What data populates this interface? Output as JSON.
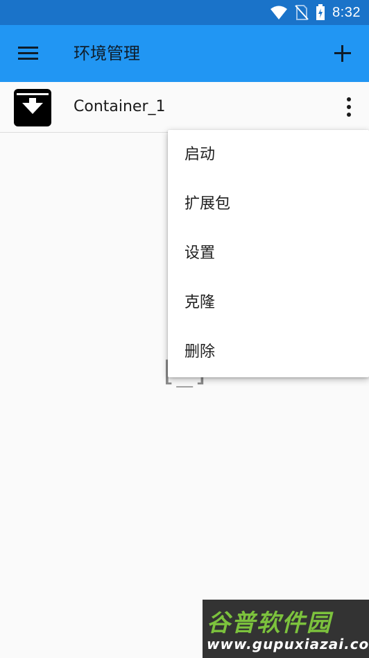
{
  "status_bar": {
    "time": "8:32",
    "icons": [
      "wifi-icon",
      "no-sim-icon",
      "battery-charging-icon"
    ]
  },
  "app_bar": {
    "title": "环境管理",
    "menu_icon": "hamburger-menu-icon",
    "add_icon": "plus-icon"
  },
  "containers": [
    {
      "label": "Container_1",
      "icon": "archive-download-icon"
    }
  ],
  "popup_menu": {
    "items": [
      "启动",
      "扩展包",
      "设置",
      "克隆",
      "删除"
    ]
  },
  "placeholder": {
    "glyph": "[_]"
  },
  "watermark": {
    "title": "谷普软件园",
    "url": "www.gupuxiazai.com"
  }
}
